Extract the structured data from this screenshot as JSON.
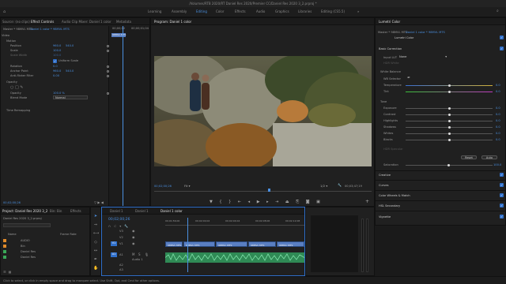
{
  "window": {
    "title": "/Volumes/RTB 2020/RT Daniel Res 2020/Premier CC/Daniel Res 2020 3_2.prproj *"
  },
  "workspaces": {
    "items": [
      "Learning",
      "Assembly",
      "Editing",
      "Color",
      "Effects",
      "Audio",
      "Graphics",
      "Libraries",
      "Editing (CS5.5)"
    ],
    "active": "Editing"
  },
  "source_panel": {
    "tabs": [
      "Source: (no clips)",
      "Effect Controls",
      "Audio Clip Mixer: Daniel 1 color",
      "Metadata"
    ],
    "master_label": "Master * 98MVL MTS",
    "clip_label": "Daniel 1 color * 98MVL MTS",
    "mini_timecode": "00;00;00",
    "mini_timecode_end": "00;00;01;04",
    "mini_clip": "98MVL MTS",
    "section_video": "Video",
    "motion": "Motion",
    "position_label": "Position",
    "position_x": "960.0",
    "position_y": "540.0",
    "scale_label": "Scale",
    "scale_value": "100.0",
    "scale_width_label": "Scale Width",
    "scale_width_value": "100.0",
    "uniform_scale": "Uniform Scale",
    "rotation_label": "Rotation",
    "rotation_value": "0.0",
    "anchor_label": "Anchor Point",
    "anchor_x": "960.0",
    "anchor_y": "540.0",
    "antiflicker_label": "Anti-flicker Filter",
    "antiflicker_value": "0.00",
    "opacity": "Opacity",
    "opacity_label": "Opacity",
    "opacity_value": "100.0 %",
    "blend_label": "Blend Mode",
    "blend_value": "Normal",
    "time_remap": "Time Remapping",
    "timecode": "00;02;00;26"
  },
  "program_monitor": {
    "tab": "Program: Daniel 1 color",
    "timecode": "00;02;00;26",
    "fit": "Fit",
    "quality": "1/2",
    "duration": "00;03;47;19"
  },
  "lumetri": {
    "tab": "Lumetri Color",
    "master_label": "Master * 98MVL MTS",
    "clip_label": "Daniel 1 color * 98MVL MTS",
    "effect_name": "Lumetri Color",
    "basic": "Basic Correction",
    "input_lut_label": "Input LUT",
    "input_lut_value": "None",
    "hdr_label": "HDR White",
    "wb_label": "White Balance",
    "wb_selector": "WB Selector",
    "temperature_label": "Temperature",
    "temperature_value": "0.0",
    "temperature_fill": 0.5,
    "tint_label": "Tint",
    "tint_value": "0.0",
    "tint_fill": 0.5,
    "tone_label": "Tone",
    "tone_rows": [
      {
        "label": "Exposure",
        "value": "0.0",
        "fill": 0.5
      },
      {
        "label": "Contrast",
        "value": "0.0",
        "fill": 0.5
      },
      {
        "label": "Highlights",
        "value": "0.0",
        "fill": 0.5
      },
      {
        "label": "Shadows",
        "value": "0.0",
        "fill": 0.5
      },
      {
        "label": "Whites",
        "value": "0.0",
        "fill": 0.5
      },
      {
        "label": "Blacks",
        "value": "0.0",
        "fill": 0.5
      }
    ],
    "hdr_specular": "HDR Specular",
    "reset": "Reset",
    "auto": "Auto",
    "saturation_label": "Saturation",
    "saturation_value": "100.0",
    "sections": [
      "Creative",
      "Curves",
      "Color Wheels & Match",
      "HSL Secondary",
      "Vignette"
    ]
  },
  "project_panel": {
    "tabs": [
      "Project: Daniel Res 2020 3_2",
      "Bin: Bin",
      "Effects"
    ],
    "file": "Daniel Res 2020 3_2.prproj",
    "column_name": "Name",
    "column_rate": "Frame Rate",
    "items": [
      "AUDIO",
      "Bin",
      "Daniel Res",
      "Daniel Res"
    ]
  },
  "timeline": {
    "tabs": [
      "Daniel 1",
      "Daniel 1",
      "Daniel 1 color"
    ],
    "timecode": "00;02;00;26",
    "ruler": [
      "00;01;56;00",
      "00;02;00;02",
      "00;02;04;04",
      "00;02;08;06",
      "00;02;12;08"
    ],
    "tracks": [
      "V3",
      "V2",
      "V1",
      "A1",
      "A2",
      "A3"
    ],
    "clips": [
      "98MVL MTS",
      "98MVL MTS",
      "98MVL MTS",
      "98MVL MTS",
      "98MVL MTS"
    ],
    "audio_name": "Audio 1"
  },
  "status": {
    "text": "Click to select, or click in empty space and drag to marquee select. Use Shift, Opt, and Cmd for other options."
  },
  "colors": {
    "accent": "#4a8fe0",
    "clip_video": "#5a7fc2",
    "clip_audio": "#3ea36a",
    "playhead": "#4a8fe0"
  }
}
